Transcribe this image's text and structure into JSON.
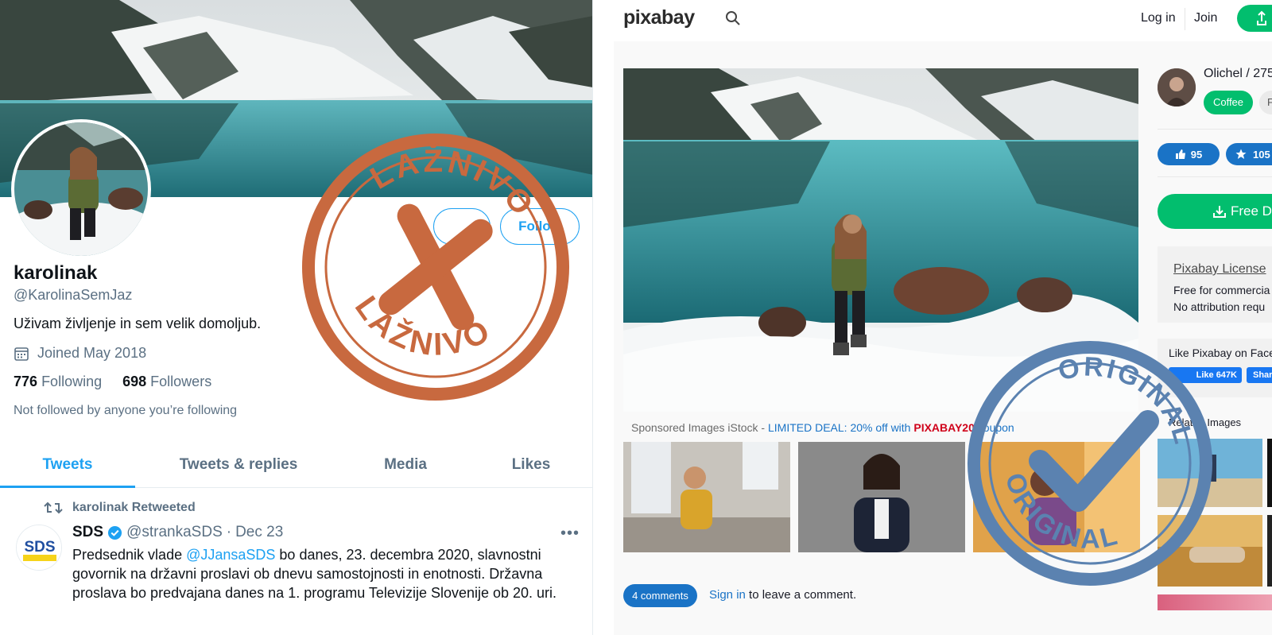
{
  "twitter": {
    "profile": {
      "name": "karolinak",
      "handle": "@KarolinaSemJaz",
      "bio": "Uživam življenje in sem velik domoljub.",
      "joined": "Joined May 2018",
      "following_count": "776",
      "following_label": "Following",
      "followers_count": "698",
      "followers_label": "Followers",
      "not_followed": "Not followed by anyone you’re following",
      "follow_button": "Follow"
    },
    "tabs": [
      {
        "label": "Tweets",
        "active": true
      },
      {
        "label": "Tweets & replies",
        "active": false
      },
      {
        "label": "Media",
        "active": false
      },
      {
        "label": "Likes",
        "active": false
      }
    ],
    "tweet": {
      "retweeted_by": "karolinak Retweeted",
      "author_name": "SDS",
      "author_handle": "@strankaSDS",
      "separator": "·",
      "date": "Dec 23",
      "more": "•••",
      "text_before": "Predsednik vlade ",
      "mention": "@JJansaSDS",
      "text_after": " bo danes, 23. decembra 2020, slavnostni govornik na državni proslavi ob dnevu samostojnosti in enotnosti. Državna proslava bo predvajana danes na 1. programu Televizije Slovenije ob 20. uri.",
      "logo_text": "SDS"
    },
    "stamp_text": "LAŽNIVO",
    "stamp_color": "#c8693f",
    "accent": "#1da1f2"
  },
  "pixabay": {
    "logo": "pixabay",
    "login": "Log in",
    "join": "Join",
    "sponsored_prefix": "Sponsored Images iStock - ",
    "sponsored_deal": "LIMITED DEAL: 20% off with ",
    "sponsored_code": "PIXABAY20",
    "sponsored_suffix": " coupon",
    "comments_button": "4 comments",
    "sign_in": "Sign in",
    "sign_in_suffix": " to leave a comment.",
    "author": "Olichel / 275",
    "coffee": "Coffee",
    "follow_short": "Fo",
    "likes": "95",
    "favorites": "105",
    "download": "Free Do",
    "license_title": "Pixabay License",
    "license_line1": "Free for commercia",
    "license_line2": "No attribution requ",
    "fb_title": "Like Pixabay on Face",
    "fb_like": "Like 647K",
    "fb_share": "Shar",
    "related": "Related Images",
    "stamp_text": "ORIGINAL",
    "stamp_color": "#5b82b0",
    "accent_green": "#02be6e",
    "accent_blue": "#1a73c6"
  }
}
